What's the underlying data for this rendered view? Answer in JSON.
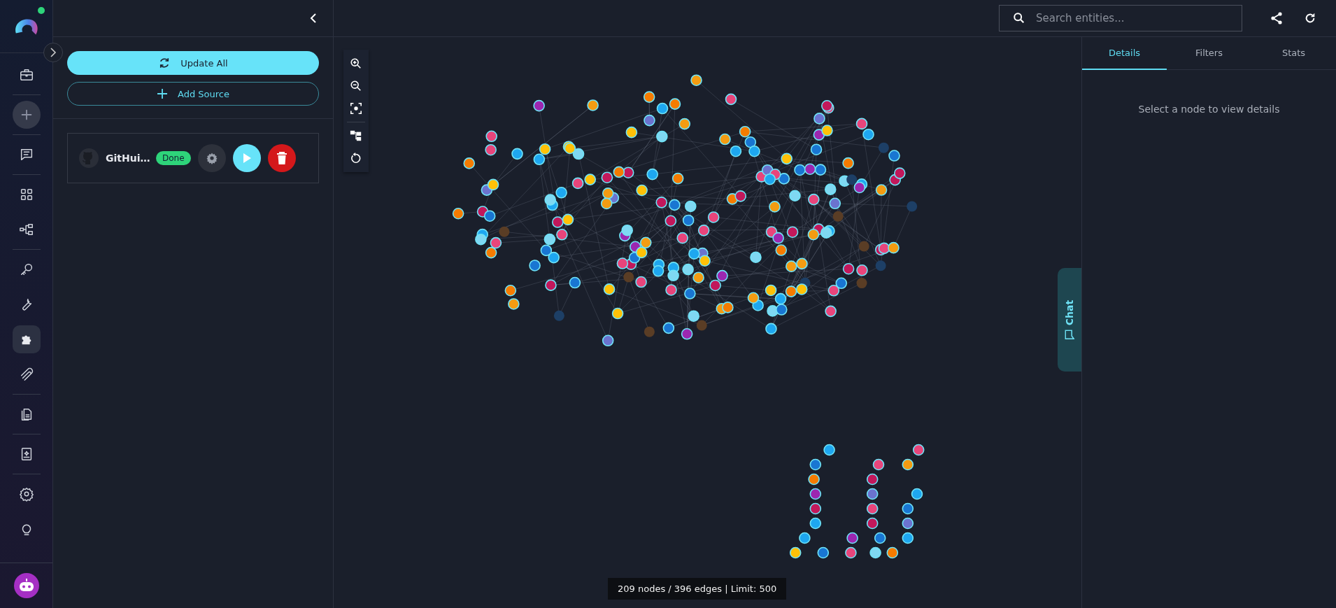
{
  "sidebar": {
    "online": true,
    "items": [
      {
        "selected": false
      },
      {
        "selected": false
      },
      {
        "selected": false
      },
      {
        "selected": false
      },
      {
        "selected": false
      },
      {
        "selected": false
      },
      {
        "selected": false
      },
      {
        "selected": true
      },
      {
        "selected": false
      },
      {
        "selected": false
      },
      {
        "selected": false
      },
      {
        "selected": false
      },
      {
        "selected": false
      }
    ]
  },
  "panel": {
    "actions": [
      {
        "label": "Update All",
        "kind": "primary"
      },
      {
        "label": "Add Source",
        "kind": "outline"
      }
    ],
    "sources": [
      {
        "name": "GitHui…",
        "status": "Done"
      }
    ]
  },
  "search": {
    "placeholder": "Search entities..."
  },
  "tabs": [
    {
      "label": "Details",
      "selected": true
    },
    {
      "label": "Filters",
      "selected": false
    },
    {
      "label": "Stats",
      "selected": false
    }
  ],
  "details": {
    "empty_message": "Select a node to view details"
  },
  "graph": {
    "status": "209 nodes / 396 edges | Limit: 500"
  },
  "chat_tab": {
    "label": "Chat"
  }
}
